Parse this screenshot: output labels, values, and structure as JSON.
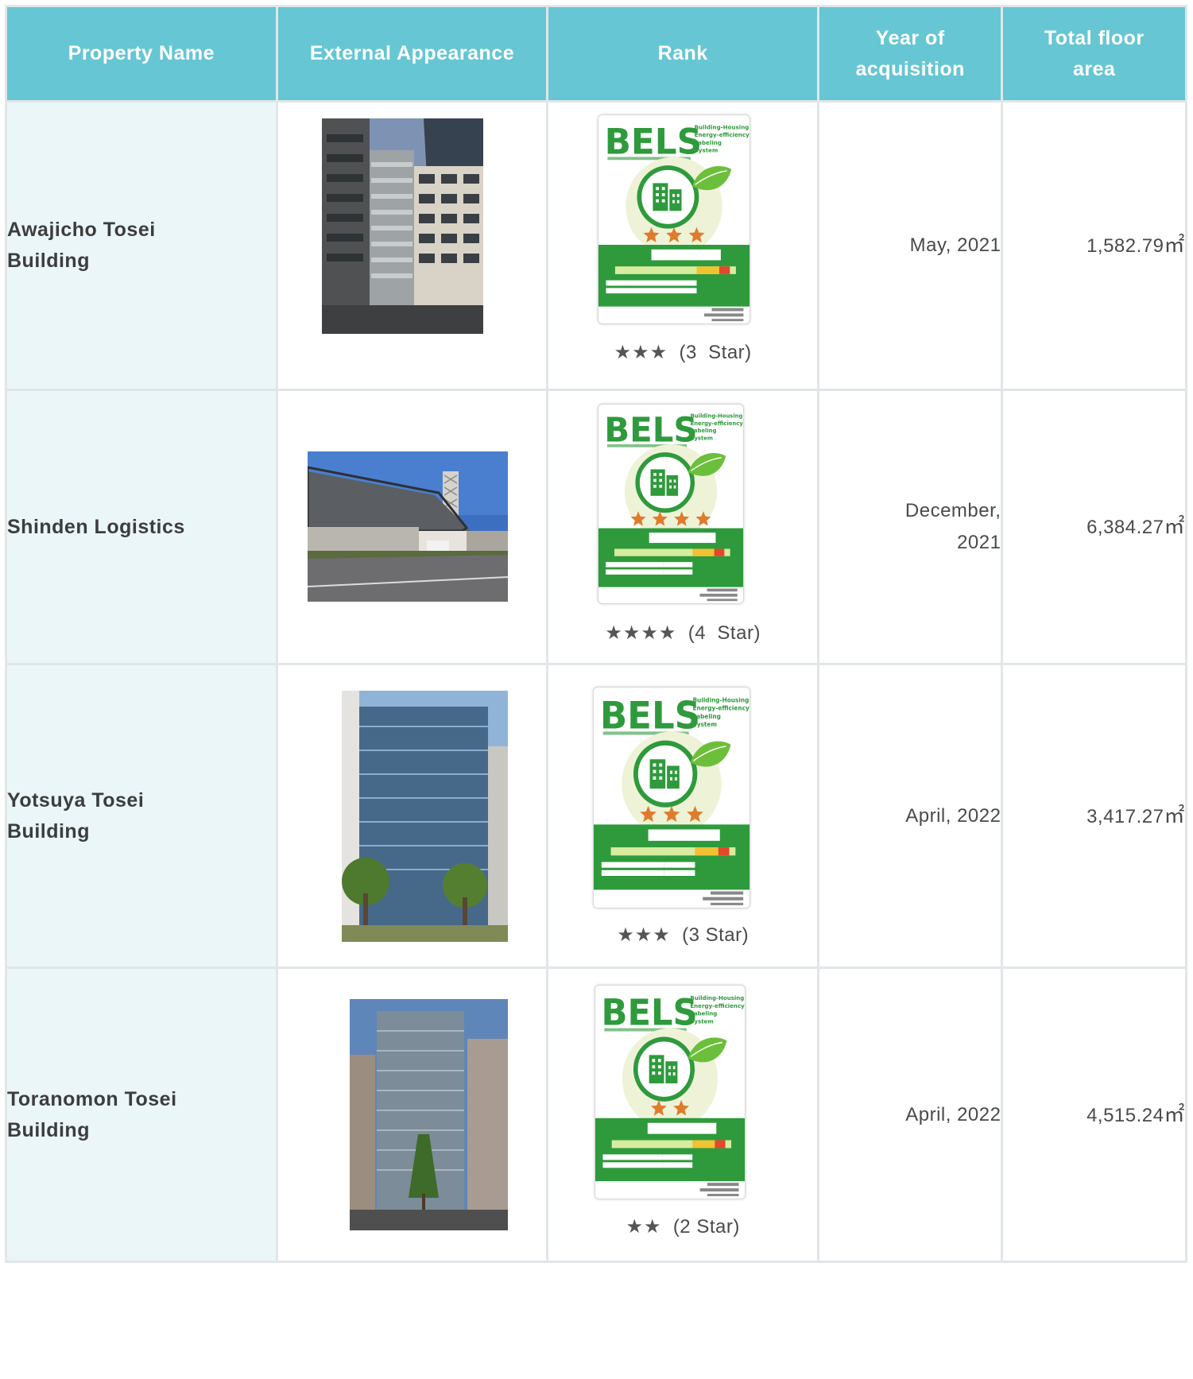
{
  "headers": {
    "property_name": "Property Name",
    "external_appearance": "External Appearance",
    "rank": "Rank",
    "year_line1": "Year of",
    "year_line2": "acquisition",
    "area_line1": "Total floor",
    "area_line2": "area"
  },
  "bels": {
    "logo": "BELS",
    "system_line1": "Building-Housing",
    "system_line2": "Energy-efficiency",
    "system_line3": "Labeling",
    "system_line4": "System"
  },
  "rows": [
    {
      "name_line1": "Awajicho Tosei",
      "name_line2": "Building",
      "photo_icon": "building-photo",
      "stars": "★★★",
      "rank_label": "(3  Star)",
      "star_count": 3,
      "year_line1": "May, 2021",
      "year_line2": "",
      "area": "1,582.79",
      "unit": "㎡"
    },
    {
      "name_line1": "Shinden Logistics",
      "name_line2": "",
      "photo_icon": "building-photo",
      "stars": "★★★★",
      "rank_label": "(4  Star)",
      "star_count": 4,
      "year_line1": "December,",
      "year_line2": "2021",
      "area": "6,384.27",
      "unit": "㎡"
    },
    {
      "name_line1": "Yotsuya Tosei",
      "name_line2": "Building",
      "photo_icon": "building-photo",
      "stars": "★★★",
      "rank_label": "(3 Star)",
      "star_count": 3,
      "year_line1": "April, 2022",
      "year_line2": "",
      "area": "3,417.27",
      "unit": "㎡"
    },
    {
      "name_line1": "Toranomon Tosei",
      "name_line2": "Building",
      "photo_icon": "building-photo",
      "stars": "★★",
      "rank_label": "(2 Star)",
      "star_count": 2,
      "year_line1": "April, 2022",
      "year_line2": "",
      "area": "4,515.24",
      "unit": "㎡"
    }
  ],
  "colors": {
    "header_bg": "#66c6d3",
    "name_cell_bg": "#eaf6f7",
    "bels_green": "#2e9a3c",
    "star_orange": "#e07b2c"
  }
}
